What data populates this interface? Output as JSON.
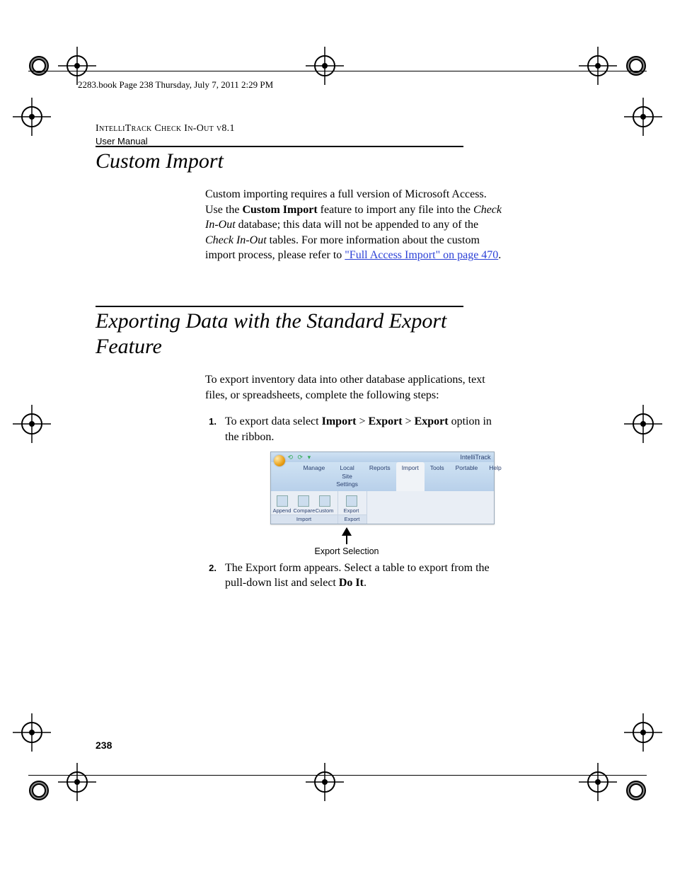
{
  "book_header": "2283.book  Page 238  Thursday, July 7, 2011  2:29 PM",
  "running_head": {
    "product": "IntelliTrack Check In-Out v8.1",
    "line2": "User Manual"
  },
  "section1": {
    "title": "Custom Import",
    "para_prefix": "Custom importing requires a full version of Microsoft Access. Use the ",
    "bold1": "Custom Import",
    "mid1": " feature to import any file into the ",
    "italic1": "Check In-Out",
    "mid2": " database; this data will not be appended to any of the ",
    "italic2": "Check In-Out",
    "mid3": " tables. For more information about the custom import process, please refer to ",
    "link_text": "\"Full Access Import\" on page 470",
    "tail": "."
  },
  "section2": {
    "title": "Exporting Data with the Standard Export Feature",
    "intro": "To export inventory data into other database applications, text files, or spreadsheets, complete the following steps:",
    "step1": {
      "num": "1.",
      "pre": "To export data select ",
      "b1": "Import",
      "sep1": " > ",
      "b2": "Export",
      "sep2": " > ",
      "b3": "Export",
      "tail": " option in the ribbon."
    },
    "step2": {
      "num": "2.",
      "pre": "The Export form appears. Select a table to export from the pull-down list and select ",
      "b1": "Do It",
      "tail": "."
    }
  },
  "ribbon": {
    "brand": "IntelliTrack",
    "tabs": [
      "Manage",
      "Local Site Settings",
      "Reports",
      "Import",
      "Tools",
      "Portable",
      "Help"
    ],
    "active_tab_index": 3,
    "group_import": {
      "label": "Import",
      "buttons": [
        "Append",
        "Compare",
        "Custom"
      ]
    },
    "group_export": {
      "label": "Export",
      "buttons": [
        "Export"
      ]
    }
  },
  "figure_caption": "Export Selection",
  "page_number": "238"
}
